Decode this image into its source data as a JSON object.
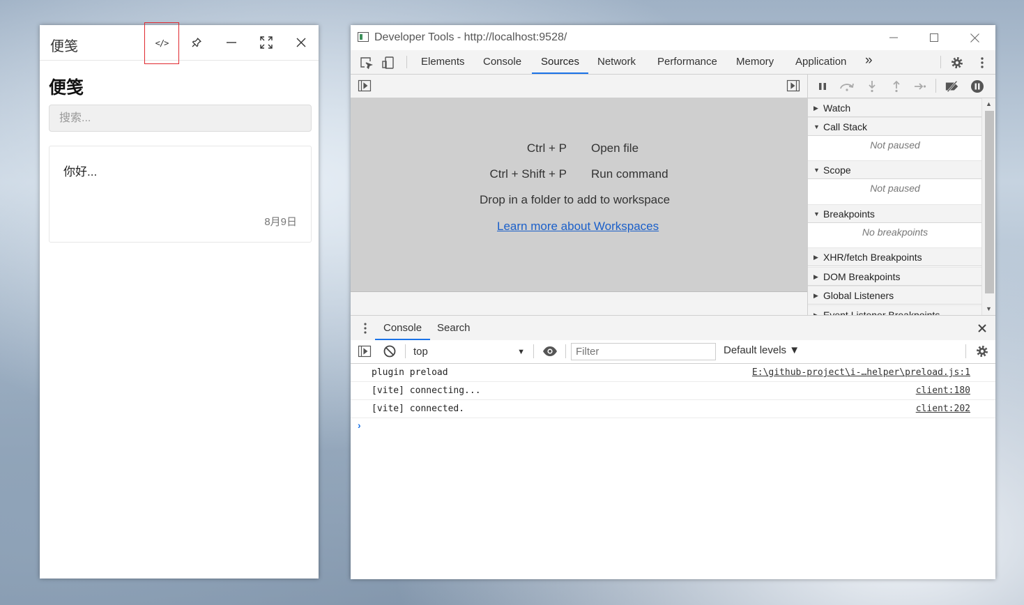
{
  "notes_window": {
    "title": "便笺",
    "heading": "便笺",
    "search_placeholder": "搜索...",
    "code_button_label": "</>",
    "note": {
      "text": "你好...",
      "date": "8月9日"
    }
  },
  "devtools": {
    "window_title": "Developer Tools - http://localhost:9528/",
    "tabs": [
      "Elements",
      "Console",
      "Sources",
      "Network",
      "Performance",
      "Memory",
      "Application"
    ],
    "active_tab": "Sources",
    "more_tabs_label": "»",
    "sources": {
      "shortcuts": [
        {
          "keys": "Ctrl + P",
          "action": "Open file"
        },
        {
          "keys": "Ctrl + Shift + P",
          "action": "Run command"
        }
      ],
      "drop_text": "Drop in a folder to add to workspace",
      "learn_link": "Learn more about Workspaces"
    },
    "debugger_sidebar": {
      "watch": "Watch",
      "call_stack": "Call Stack",
      "call_stack_status": "Not paused",
      "scope": "Scope",
      "scope_status": "Not paused",
      "breakpoints": "Breakpoints",
      "breakpoints_status": "No breakpoints",
      "xhr": "XHR/fetch Breakpoints",
      "dom": "DOM Breakpoints",
      "global": "Global Listeners",
      "event": "Event Listener Breakpoints"
    },
    "drawer": {
      "tabs": [
        "Console",
        "Search"
      ],
      "context": "top",
      "filter_placeholder": "Filter",
      "levels": "Default levels ▼",
      "logs": [
        {
          "message": "plugin preload",
          "source": "E:\\github-project\\i-…helper\\preload.js:1"
        },
        {
          "message": "[vite] connecting...",
          "source": "client:180"
        },
        {
          "message": "[vite] connected.",
          "source": "client:202"
        }
      ],
      "prompt": "›"
    }
  },
  "colors": {
    "accent_blue": "#1a73e8",
    "highlight_red": "#e0282e",
    "sources_panel_bg": "#cfcfcf"
  }
}
